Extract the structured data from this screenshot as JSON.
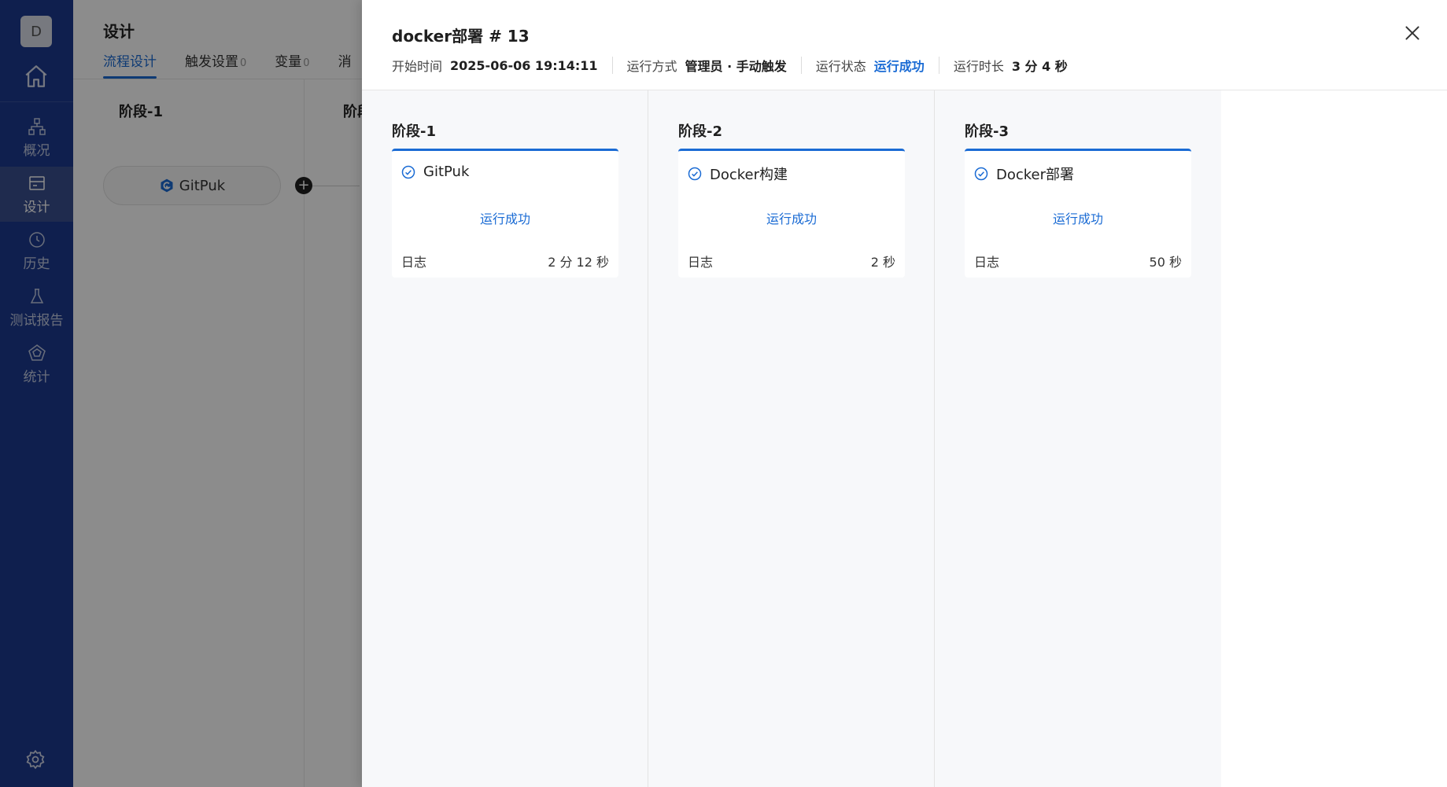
{
  "sidebar": {
    "avatar": "D",
    "items": [
      {
        "label": "概况",
        "icon": "overview-icon"
      },
      {
        "label": "设计",
        "icon": "design-icon"
      },
      {
        "label": "历史",
        "icon": "history-icon"
      },
      {
        "label": "测试报告",
        "icon": "test-report-icon"
      },
      {
        "label": "统计",
        "icon": "statistics-icon"
      }
    ],
    "active_item": "设计"
  },
  "background_page": {
    "title": "设计",
    "tabs": [
      {
        "label": "流程设计",
        "count": ""
      },
      {
        "label": "触发设置",
        "count": "0"
      },
      {
        "label": "变量",
        "count": "0"
      },
      {
        "label": "消",
        "count": ""
      }
    ],
    "stage_1_label": "阶段-1",
    "stage_2_label": "阶段",
    "task_label": "GitPuk"
  },
  "drawer": {
    "title": "docker部署 # 13",
    "meta": {
      "start_time_label": "开始时间",
      "start_time": "2025-06-06 19:14:11",
      "run_mode_label": "运行方式",
      "run_mode": "管理员 · 手动触发",
      "run_status_label": "运行状态",
      "run_status": "运行成功",
      "duration_label": "运行时长",
      "duration": "3 分 4 秒"
    },
    "stages": [
      {
        "name": "阶段-1",
        "task": "GitPuk",
        "status": "运行成功",
        "log_label": "日志",
        "duration": "2 分 12 秒"
      },
      {
        "name": "阶段-2",
        "task": "Docker构建",
        "status": "运行成功",
        "log_label": "日志",
        "duration": "2 秒"
      },
      {
        "name": "阶段-3",
        "task": "Docker部署",
        "status": "运行成功",
        "log_label": "日志",
        "duration": "50 秒"
      }
    ]
  },
  "colors": {
    "sidebar_bg": "#1d3a8f",
    "accent": "#1a6bd4",
    "stage_bg": "#f7f8fa"
  }
}
